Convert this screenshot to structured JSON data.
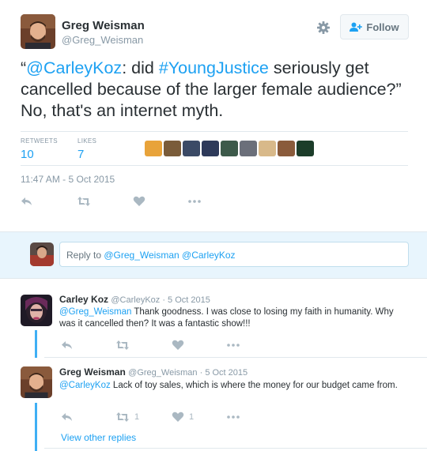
{
  "tweet": {
    "author_name": "Greg Weisman",
    "author_handle": "@Greg_Weisman",
    "follow_label": "Follow",
    "text_parts": {
      "open_quote": "“",
      "mention": "@CarleyKoz",
      "part1": ": did ",
      "hashtag": "#YoungJustice",
      "part2": " seriously get cancelled because of the larger female audience?” No, that's an internet myth."
    },
    "retweets_label": "RETWEETS",
    "retweets_count": "10",
    "likes_label": "LIKES",
    "likes_count": "7",
    "timestamp": "11:47 AM - 5 Oct 2015",
    "liker_colors": [
      "#e8a33a",
      "#7a5c3a",
      "#3b4a66",
      "#2e3a5a",
      "#3d5a4a",
      "#6b6f7a",
      "#d8b98a",
      "#8a5b3b",
      "#1c3d2a"
    ]
  },
  "reply_box": {
    "placeholder_prefix": "Reply to ",
    "placeholder_mentions": "@Greg_Weisman @CarleyKoz"
  },
  "replies": [
    {
      "name": "Carley Koz",
      "meta": "@CarleyKoz · 5 Oct 2015",
      "mention": "@Greg_Weisman",
      "text": " Thank goodness. I was close to losing my faith in humanity. Why was it cancelled then? It was a fantastic show!!!",
      "retweets": "",
      "likes": ""
    },
    {
      "name": "Greg Weisman",
      "meta": "@Greg_Weisman · 5 Oct 2015",
      "mention": "@CarleyKoz",
      "text": " Lack of toy sales, which is where the money for our budget came from.",
      "retweets": "1",
      "likes": "1"
    }
  ],
  "view_more": "View other replies",
  "colors": {
    "link": "#1da1f2",
    "muted": "#8899a6",
    "reply_bar_bg": "#e8f5fd"
  }
}
